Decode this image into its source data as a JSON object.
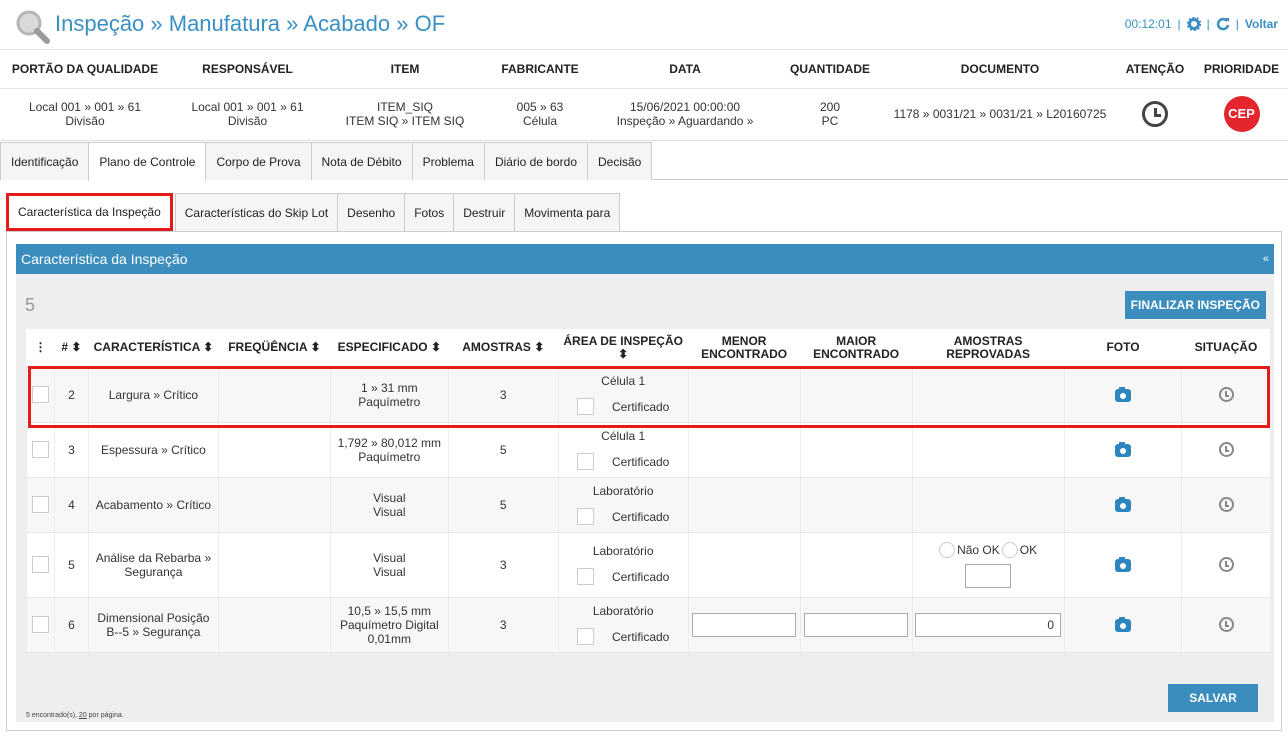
{
  "header": {
    "title": "Inspeção » Manufatura » Acabado » OF",
    "timer": "00:12:01",
    "separator": "|",
    "back_label": "Voltar"
  },
  "info": {
    "columns": [
      "PORTÃO DA QUALIDADE",
      "RESPONSÁVEL",
      "ITEM",
      "FABRICANTE",
      "DATA",
      "QUANTIDADE",
      "DOCUMENTO",
      "ATENÇÃO",
      "PRIORIDADE"
    ],
    "portao": [
      "Local 001 » 001 » 61",
      "Divisão"
    ],
    "responsavel": [
      "Local 001 » 001 » 61",
      "Divisão"
    ],
    "item": [
      "ITEM_SIQ",
      "ITEM SIQ » ITEM SIQ"
    ],
    "fabricante": [
      "005 » 63",
      "Célula"
    ],
    "data": [
      "15/06/2021 00:00:00",
      "Inspeção » Aguardando »"
    ],
    "quantidade": [
      "200",
      "PC"
    ],
    "documento": "1178 » 0031/21 » 0031/21 » L20160725",
    "prioridade_badge": "CEP"
  },
  "tabs_main": [
    "Identificação",
    "Plano de Controle",
    "Corpo de Prova",
    "Nota de Débito",
    "Problema",
    "Diário de bordo",
    "Decisão"
  ],
  "tabs_sub": [
    "Característica da Inspeção",
    "Características do Skip Lot",
    "Desenho",
    "Fotos",
    "Destruir",
    "Movimenta para"
  ],
  "panel": {
    "title": "Característica da Inspeção",
    "collapse": "«",
    "count": "5",
    "finalize_label": "FINALIZAR INSPEÇÃO",
    "footer_pre": "5 encontrado(s), ",
    "footer_link": "20",
    "footer_post": " por página.",
    "save_label": "SALVAR"
  },
  "grid": {
    "headers": {
      "menu": "⋮",
      "num": "# ⬍",
      "caracteristica": "CARACTERÍSTICA ⬍",
      "frequencia": "FREQÜÊNCIA ⬍",
      "especificado": "ESPECIFICADO ⬍",
      "amostras": "AMOSTRAS ⬍",
      "area": "ÁREA DE INSPEÇÃO ⬍",
      "menor": "MENOR ENCONTRADO",
      "maior": "MAIOR ENCONTRADO",
      "reprovadas": "AMOSTRAS REPROVADAS",
      "foto": "FOTO",
      "situacao": "SITUAÇÃO"
    },
    "rows": [
      {
        "num": "2",
        "caracteristica": "Largura » Crítico",
        "espec1": "1 » 31 mm",
        "espec2": "Paquímetro",
        "espec3": "",
        "amostras": "3",
        "area": "Célula 1",
        "cert": "Certificado"
      },
      {
        "num": "3",
        "caracteristica": "Espessura » Crítico",
        "espec1": "1,792 » 80,012 mm",
        "espec2": "Paquímetro",
        "espec3": "",
        "amostras": "5",
        "area": "Célula 1",
        "cert": "Certificado"
      },
      {
        "num": "4",
        "caracteristica": "Acabamento » Crítico",
        "espec1": "Visual",
        "espec2": "Visual",
        "espec3": "",
        "amostras": "5",
        "area": "Laboratório",
        "cert": "Certificado"
      },
      {
        "num": "5",
        "caracteristica": "Análise da Rebarba » Segurança",
        "espec1": "Visual",
        "espec2": "Visual",
        "espec3": "",
        "amostras": "3",
        "area": "Laboratório",
        "cert": "Certificado",
        "radio_nok": "Não OK",
        "radio_ok": "OK"
      },
      {
        "num": "6",
        "caracteristica": "Dimensional Posição B--5 » Segurança",
        "espec1": "10,5 » 15,5 mm",
        "espec2": "Paquímetro Digital",
        "espec3": "0,01mm",
        "amostras": "3",
        "area": "Laboratório",
        "cert": "Certificado",
        "reprovadas_value": "0"
      }
    ]
  },
  "colors": {
    "accent": "#3b8dbd",
    "highlight": "#e31b1b",
    "cep": "#e3262d"
  }
}
